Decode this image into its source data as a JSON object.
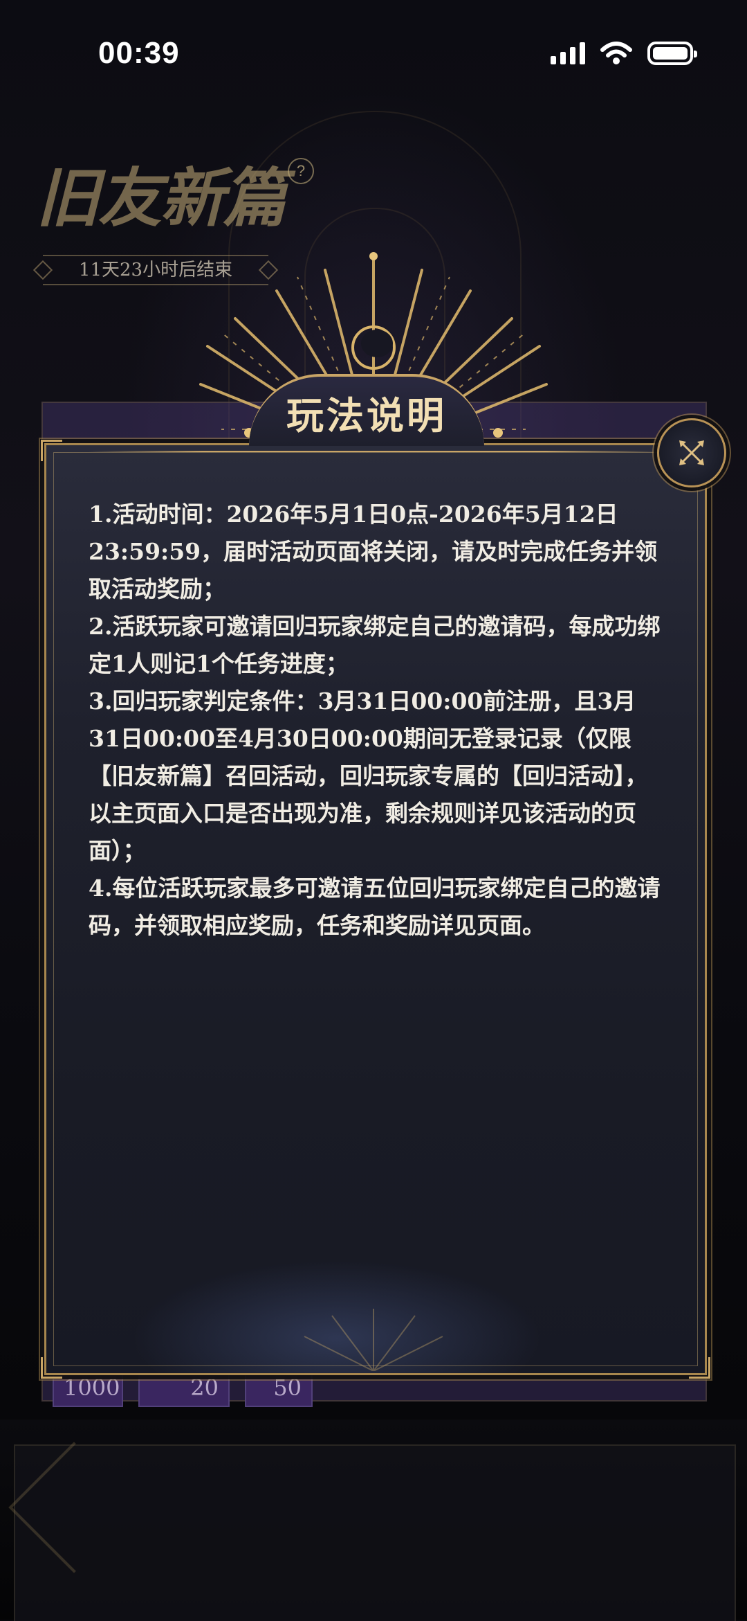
{
  "status_bar": {
    "time": "00:39"
  },
  "event": {
    "title": "旧友新篇",
    "help_glyph": "?",
    "countdown": "11天23小时后结束"
  },
  "background_chips": [
    "1000",
    "20",
    "50"
  ],
  "modal": {
    "title": "玩法说明",
    "rules": [
      "1.活动时间：2026年5月1日0点-2026年5月12日23:59:59，届时活动页面将关闭，请及时完成任务并领取活动奖励；",
      "2.活跃玩家可邀请回归玩家绑定自己的邀请码，每成功绑定1人则记1个任务进度；",
      "3.回归玩家判定条件：3月31日00:00前注册，且3月31日00:00至4月30日00:00期间无登录记录（仅限【旧友新篇】召回活动，回归玩家专属的【回归活动】，以主页面入口是否出现为准，剩余规则详见该活动的页面）；",
      "4.每位活跃玩家最多可邀请五位回归玩家绑定自己的邀请码，并领取相应奖励，任务和奖励详见页面。"
    ]
  },
  "icons": {
    "close": "close-ornate-icon",
    "signal": "cellular-signal-icon",
    "wifi": "wifi-icon",
    "battery": "battery-icon",
    "help": "help-icon"
  },
  "colors": {
    "gold": "#c9a566",
    "title_text": "#f2dfb4",
    "body_text": "#f1ede4",
    "modal_bg": "#1f212d"
  }
}
